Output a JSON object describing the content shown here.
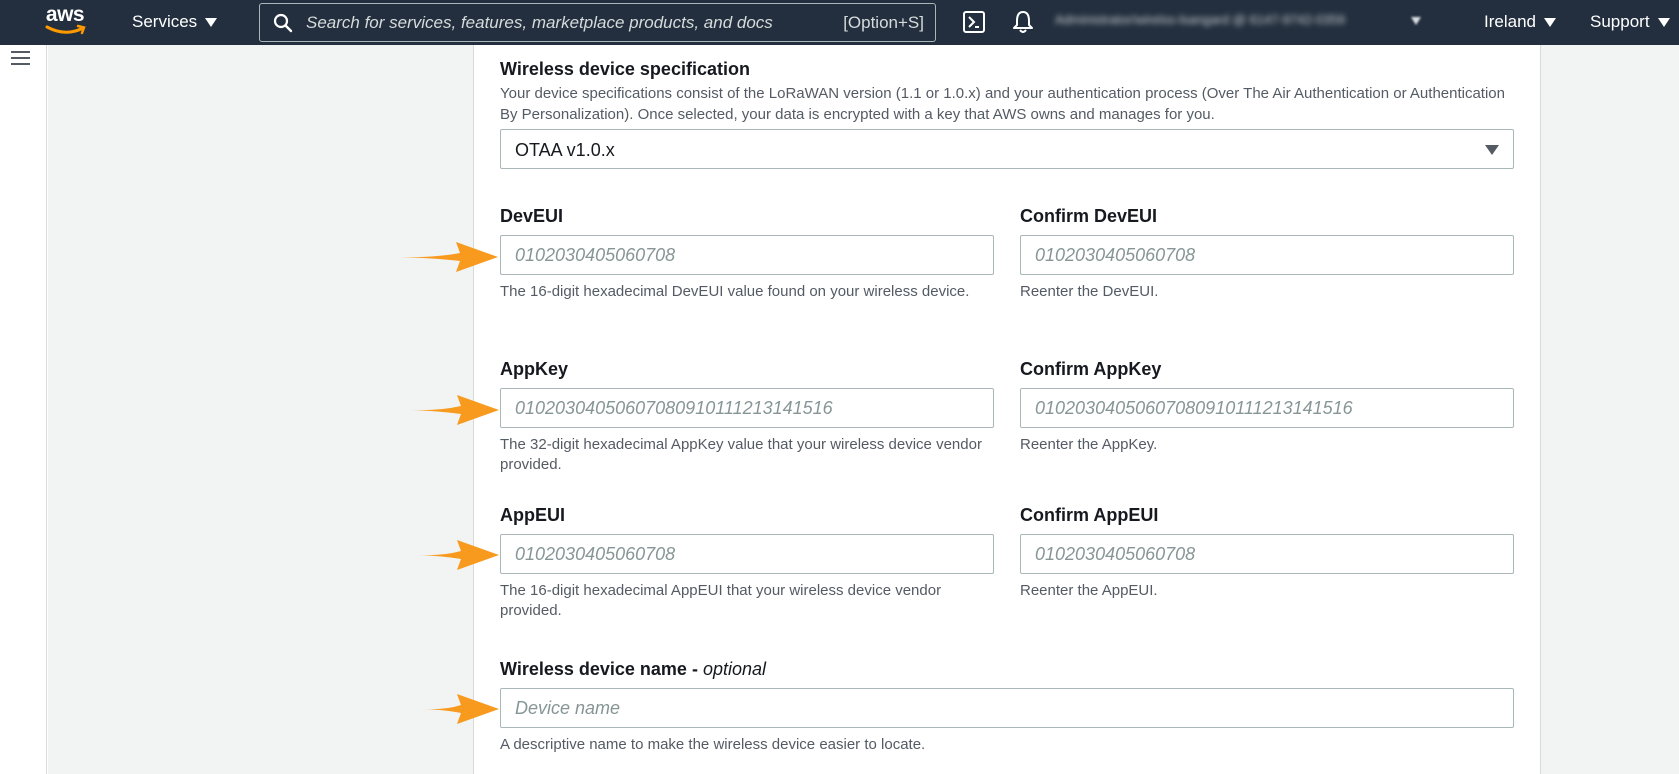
{
  "nav": {
    "logo_text": "aws",
    "services_label": "Services",
    "search_placeholder": "Search for services, features, marketplace products, and docs",
    "search_shortcut": "[Option+S]",
    "account_label": "Administrator/wirelss-lsangard @ 6147-9742-0359",
    "region_label": "Ireland",
    "support_label": "Support"
  },
  "form": {
    "spec": {
      "label": "Wireless device specification",
      "description": "Your device specifications consist of the LoRaWAN version (1.1 or 1.0.x) and your authentication process (Over The Air Authentication or Authentication By Personalization). Once selected, your data is encrypted with a key that AWS owns and manages for you.",
      "selected": "OTAA v1.0.x"
    },
    "deveui": {
      "label": "DevEUI",
      "placeholder": "0102030405060708",
      "description": "The 16-digit hexadecimal DevEUI value found on your wireless device.",
      "confirm_label": "Confirm DevEUI",
      "confirm_placeholder": "0102030405060708",
      "confirm_description": "Reenter the DevEUI."
    },
    "appkey": {
      "label": "AppKey",
      "placeholder": "01020304050607080910111213141516",
      "description": "The 32-digit hexadecimal AppKey value that your wireless device vendor provided.",
      "confirm_label": "Confirm AppKey",
      "confirm_placeholder": "01020304050607080910111213141516",
      "confirm_description": "Reenter the AppKey."
    },
    "appeui": {
      "label": "AppEUI",
      "placeholder": "0102030405060708",
      "description": "The 16-digit hexadecimal AppEUI that your wireless device vendor provided.",
      "confirm_label": "Confirm AppEUI",
      "confirm_placeholder": "0102030405060708",
      "confirm_description": "Reenter the AppEUI."
    },
    "device_name": {
      "label": "Wireless device name - ",
      "label_optional": "optional",
      "placeholder": "Device name",
      "description": "A descriptive name to make the wireless device easier to locate."
    }
  },
  "colors": {
    "nav_bg": "#232f3e",
    "annotation_arrow": "#f79a1e",
    "page_gray": "#f2f3f3"
  }
}
